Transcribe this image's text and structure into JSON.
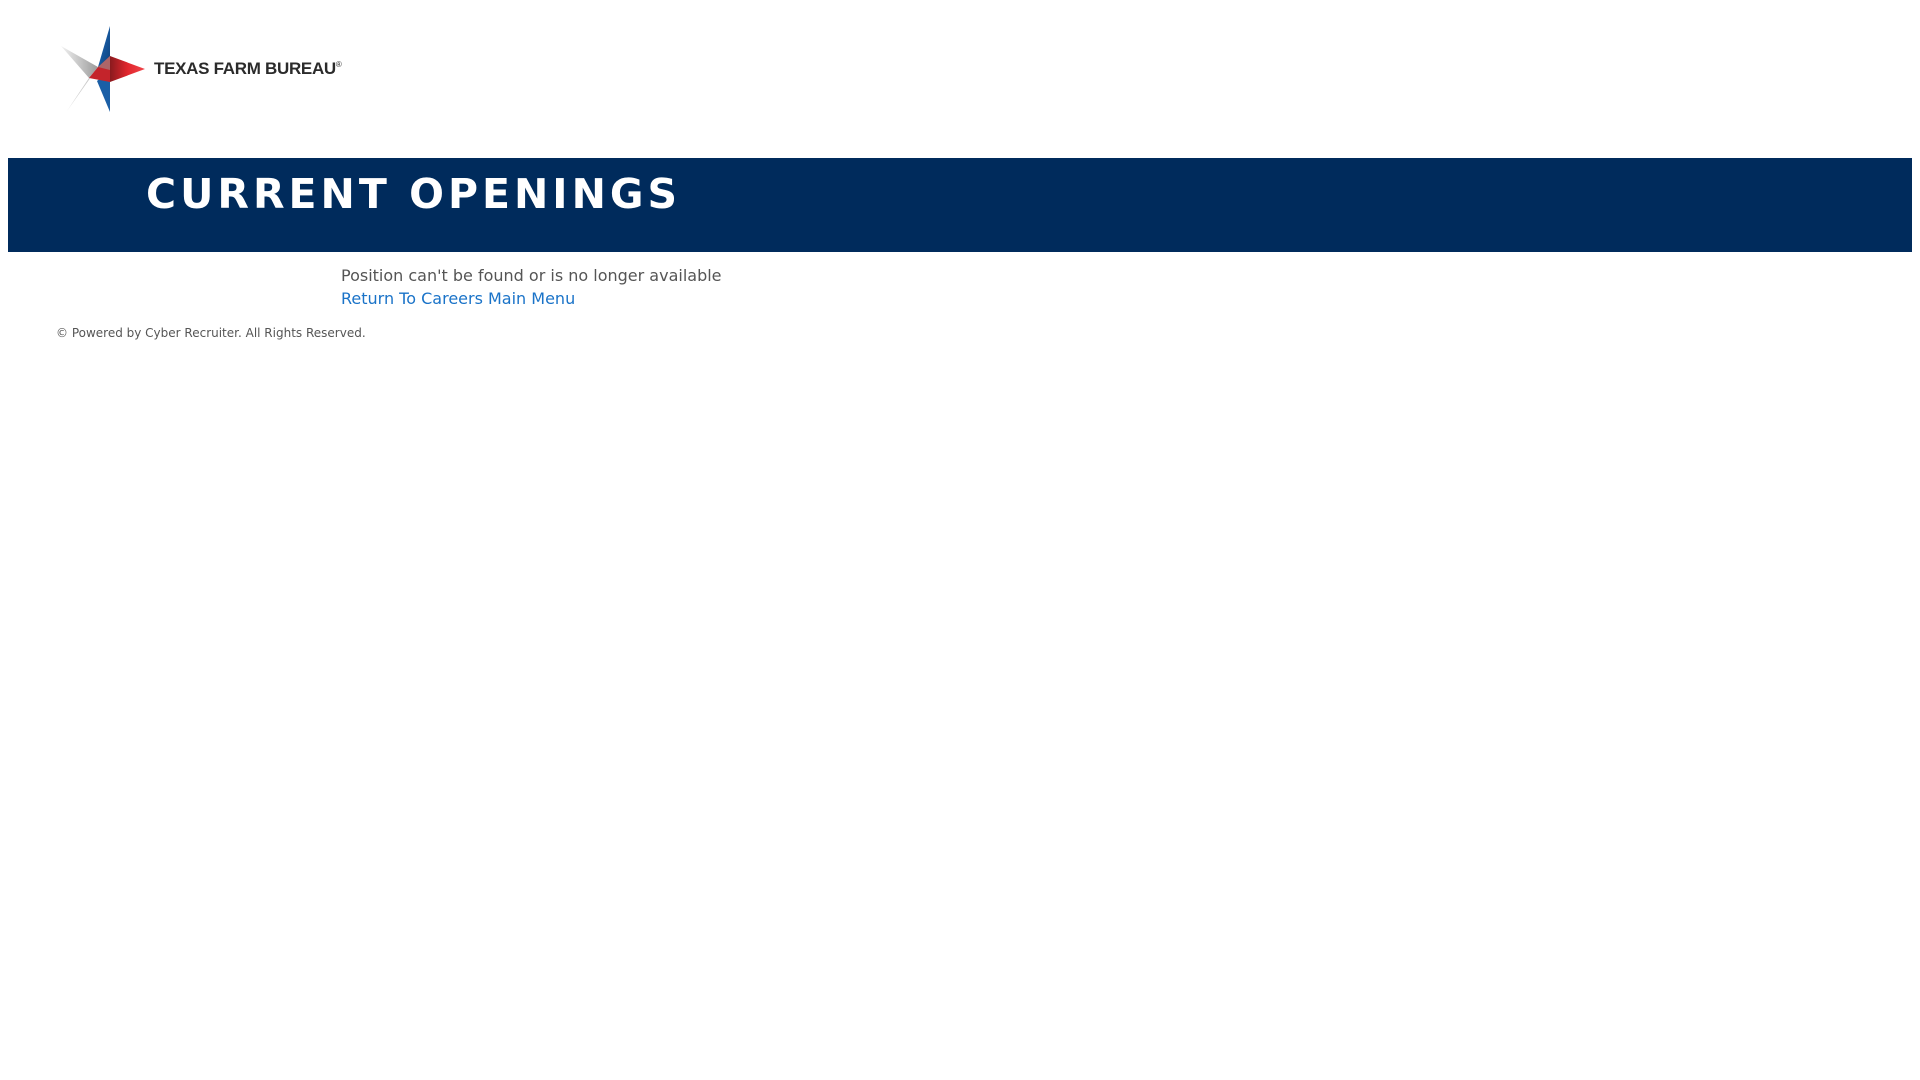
{
  "header": {
    "logo": {
      "icon": "texas-star-logo",
      "text": "TEXAS FARM BUREAU",
      "registered_mark": "®"
    }
  },
  "banner": {
    "title": "CURRENT OPENINGS",
    "background_color": "#002b5c"
  },
  "main": {
    "message": "Position can't be found or is no longer available",
    "return_link": "Return To Careers Main Menu"
  },
  "footer": {
    "copyright": "© Powered by Cyber Recruiter. All Rights Reserved."
  },
  "colors": {
    "banner": "#002b5c",
    "link": "#1a73c8",
    "text": "#555555",
    "star_red": "#d2232a",
    "star_blue": "#1f5fa8",
    "star_gray": "#b8b8b8"
  }
}
